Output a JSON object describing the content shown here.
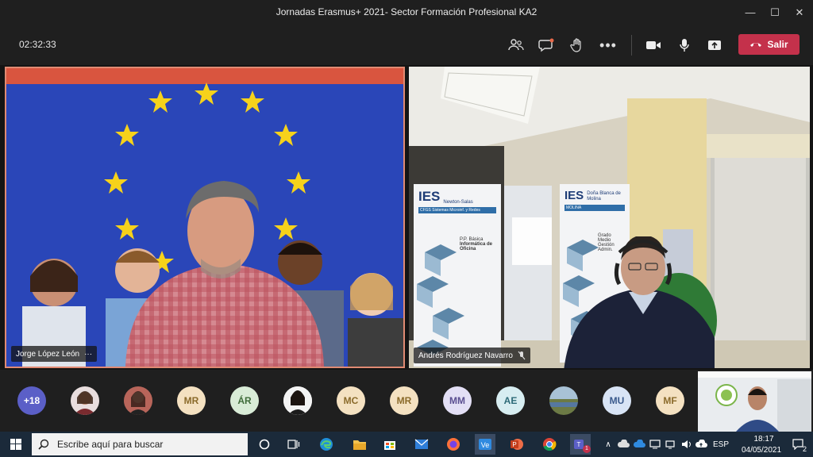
{
  "window": {
    "title": "Jornadas Erasmus+ 2021- Sector Formación Profesional KA2",
    "controls": {
      "minimize": "—",
      "maximize": "☐",
      "close": "✕"
    }
  },
  "meeting": {
    "timer": "02:32:33",
    "leave_label": "Salir",
    "accent": "#c4314b"
  },
  "participants_main": [
    {
      "name": "Jorge López León",
      "more": "···"
    },
    {
      "name": "Andrés Rodríguez Navarro",
      "mic": "mic-off-icon"
    }
  ],
  "banners": {
    "left": {
      "brand": "IES",
      "line1": "Newton-Salas",
      "line2": "CFGS Sistemas Microinf. y Redes",
      "line3": "P.P. Básica",
      "line4": "Informática de Oficina"
    },
    "right": {
      "brand": "IES",
      "line1": "Doña Blanca de Molina",
      "line2": "MOLINA",
      "line3": "Grado Medio",
      "line4": "Gestión Admin."
    }
  },
  "roster": [
    {
      "label": "+18",
      "kind": "count"
    },
    {
      "label": "",
      "kind": "photo"
    },
    {
      "label": "",
      "kind": "photo"
    },
    {
      "label": "MR",
      "kind": "initials",
      "bg": "#f4e1c1",
      "fg": "#8a6a2a"
    },
    {
      "label": "ÁR",
      "kind": "initials",
      "bg": "#d9ecd7",
      "fg": "#3f6c3a"
    },
    {
      "label": "",
      "kind": "photo"
    },
    {
      "label": "MC",
      "kind": "initials",
      "bg": "#f4e1c1",
      "fg": "#8a6a2a"
    },
    {
      "label": "MR",
      "kind": "initials",
      "bg": "#f4e1c1",
      "fg": "#8a6a2a"
    },
    {
      "label": "MM",
      "kind": "initials",
      "bg": "#e3dff5",
      "fg": "#5b4f91"
    },
    {
      "label": "AE",
      "kind": "initials",
      "bg": "#d7edf1",
      "fg": "#2d6a78"
    },
    {
      "label": "",
      "kind": "photo"
    },
    {
      "label": "MU",
      "kind": "initials",
      "bg": "#d8e4f5",
      "fg": "#3a5a8c"
    },
    {
      "label": "MF",
      "kind": "initials",
      "bg": "#f4e1c1",
      "fg": "#8a6a2a"
    }
  ],
  "taskbar": {
    "search_placeholder": "Escribe aquí para buscar",
    "language": "ESP",
    "time": "18:17",
    "date": "04/05/2021",
    "notifications": "2",
    "teams_badge": "1"
  }
}
